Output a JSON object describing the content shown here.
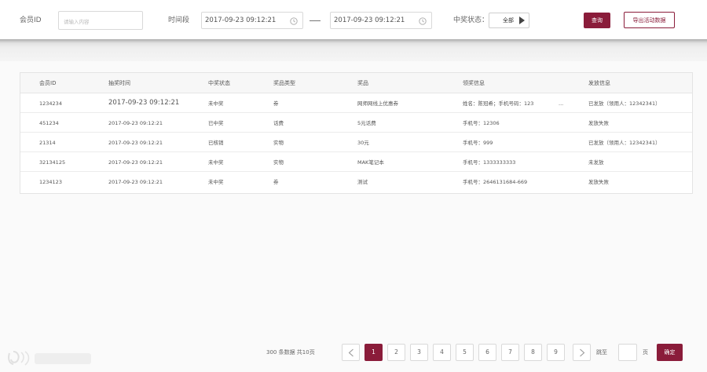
{
  "filters": {
    "member_id_label": "会员ID",
    "member_id_placeholder": "请输入内容",
    "member_id_value": "",
    "period_label": "时间段",
    "start_time": "2017-09-23 09:12:21",
    "end_time": "2017-09-23 09:12:21",
    "win_status_label": "中奖状态：",
    "win_status_value": "全部",
    "query_button": "查询",
    "export_button": "导出活动数据"
  },
  "table": {
    "columns": [
      "会员ID",
      "抽奖时间",
      "中奖状态",
      "奖品类型",
      "奖品",
      "领奖信息",
      "发放信息"
    ],
    "rows": [
      {
        "member_id": "1234234",
        "draw_time": "2017-09-23 09:12:21",
        "win_status": "未中奖",
        "prize_type": "券",
        "prize": "网师网线上优惠券",
        "claim_info": "姓名：陈冠希；手机号码：123",
        "claim_more": "...",
        "dispatch_info": "已发放（领用人：12342341）"
      },
      {
        "member_id": "451234",
        "draw_time": "2017-09-23 09:12:21",
        "win_status": "已中奖",
        "prize_type": "话费",
        "prize": "5元话费",
        "claim_info": "手机号：12306",
        "claim_more": "",
        "dispatch_info": "发放失败"
      },
      {
        "member_id": "21314",
        "draw_time": "2017-09-23 09:12:21",
        "win_status": "已核销",
        "prize_type": "实物",
        "prize": "30元",
        "claim_info": "手机号：999",
        "claim_more": "",
        "dispatch_info": "已发放（领用人：12342341）"
      },
      {
        "member_id": "32134125",
        "draw_time": "2017-09-23 09:12:21",
        "win_status": "未中奖",
        "prize_type": "实物",
        "prize": "MAK笔记本",
        "claim_info": "手机号：1333333333",
        "claim_more": "",
        "dispatch_info": "未发放"
      },
      {
        "member_id": "1234123",
        "draw_time": "2017-09-23 09:12:21",
        "win_status": "未中奖",
        "prize_type": "券",
        "prize": "测试",
        "claim_info": "手机号：2646131684-669",
        "claim_more": "",
        "dispatch_info": "发放失败"
      }
    ]
  },
  "pagination": {
    "total_text": "300 条数据  共10页",
    "pages": [
      "1",
      "2",
      "3",
      "4",
      "5",
      "6",
      "7",
      "8",
      "9"
    ],
    "current_page": 1,
    "jump_label": "跳至",
    "jump_value": "",
    "page_unit": "页",
    "confirm_button": "确定"
  },
  "icons": {
    "date": "clock-icon",
    "select": "triangle-right-icon",
    "prev": "chevron-left-icon",
    "next": "chevron-right-icon"
  },
  "colors": {
    "accent": "#8a1c3a"
  }
}
